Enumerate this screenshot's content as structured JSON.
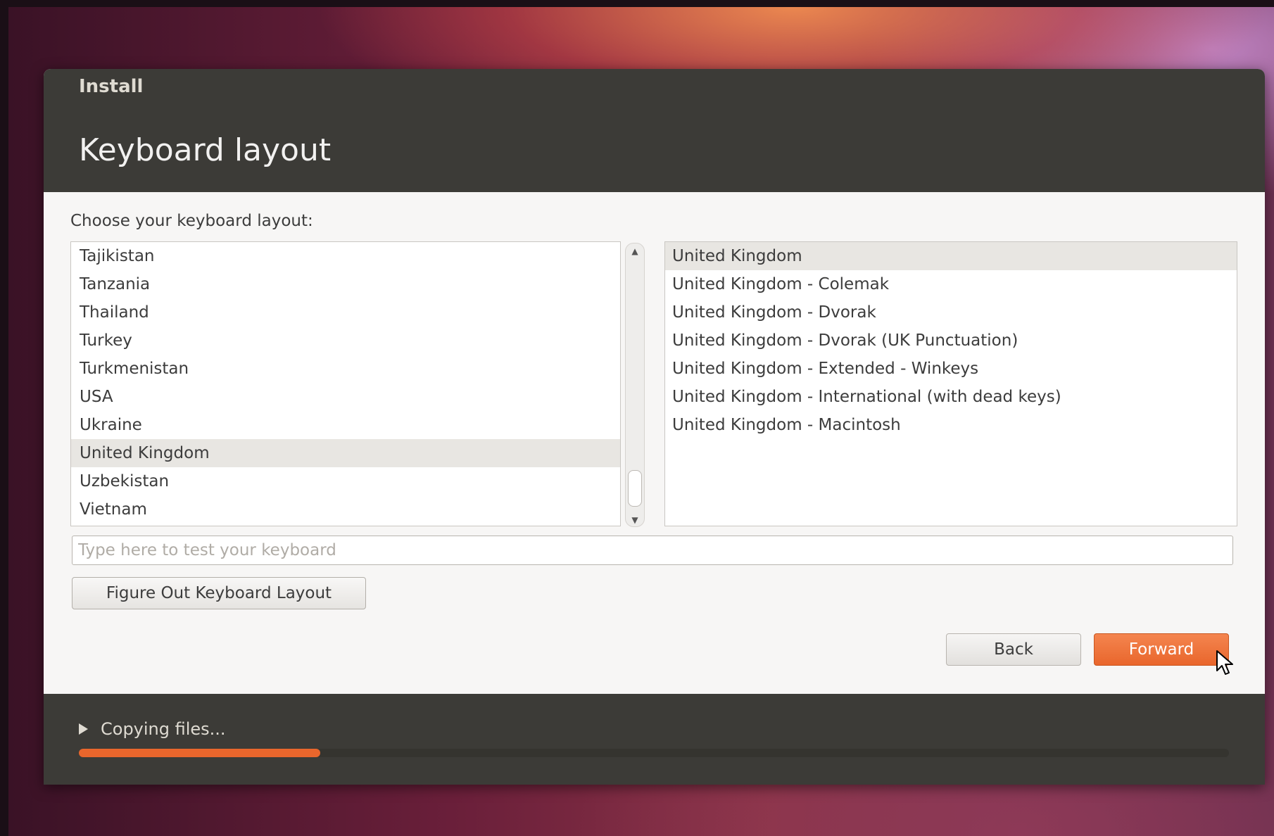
{
  "window": {
    "title": "Install",
    "page_title": "Keyboard layout"
  },
  "layout_chooser": {
    "label": "Choose your keyboard layout:",
    "countries": [
      {
        "label": "Tajikistan",
        "selected": false
      },
      {
        "label": "Tanzania",
        "selected": false
      },
      {
        "label": "Thailand",
        "selected": false
      },
      {
        "label": "Turkey",
        "selected": false
      },
      {
        "label": "Turkmenistan",
        "selected": false
      },
      {
        "label": "USA",
        "selected": false
      },
      {
        "label": "Ukraine",
        "selected": false
      },
      {
        "label": "United Kingdom",
        "selected": true
      },
      {
        "label": "Uzbekistan",
        "selected": false
      },
      {
        "label": "Vietnam",
        "selected": false
      }
    ],
    "variants": [
      {
        "label": "United Kingdom",
        "selected": true
      },
      {
        "label": "United Kingdom - Colemak",
        "selected": false
      },
      {
        "label": "United Kingdom - Dvorak",
        "selected": false
      },
      {
        "label": "United Kingdom - Dvorak (UK Punctuation)",
        "selected": false
      },
      {
        "label": "United Kingdom - Extended - Winkeys",
        "selected": false
      },
      {
        "label": "United Kingdom - International (with dead keys)",
        "selected": false
      },
      {
        "label": "United Kingdom - Macintosh",
        "selected": false
      }
    ]
  },
  "test_field": {
    "placeholder": "Type here to test your keyboard",
    "value": ""
  },
  "buttons": {
    "figure_out": "Figure Out Keyboard Layout",
    "back": "Back",
    "forward": "Forward"
  },
  "status": {
    "text": "Copying files...",
    "progress": 0.21
  },
  "colors": {
    "accent": "#e9662c",
    "header_bg": "#3c3b37",
    "content_bg": "#f7f6f5"
  }
}
